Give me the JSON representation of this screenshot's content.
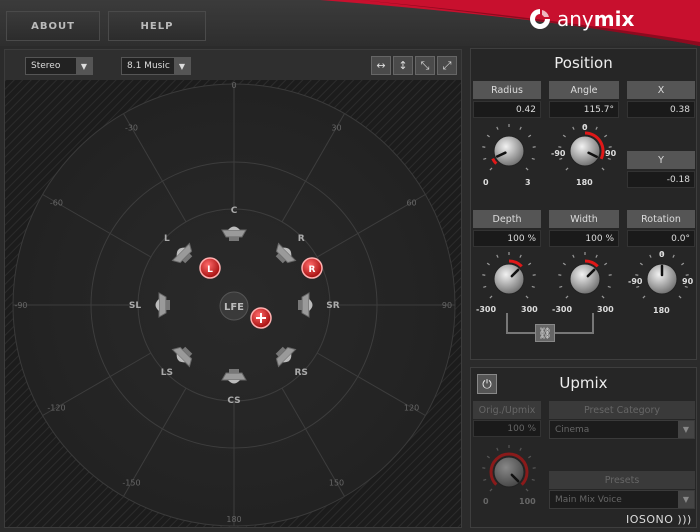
{
  "header": {
    "about_label": "ABOUT",
    "help_label": "HELP",
    "brand_prefix": "any",
    "brand_bold": "mix",
    "accent_color": "#c8102e"
  },
  "toolbar": {
    "input_format": "Stereo",
    "output_format": "8.1 Music",
    "zoom_icons": [
      "horizontal-arrows-icon",
      "vertical-arrows-icon",
      "diagonal-down-arrows-icon",
      "diagonal-up-arrows-icon"
    ]
  },
  "stage": {
    "angle_labels": [
      "0",
      "30",
      "60",
      "90",
      "120",
      "150",
      "180",
      "-150",
      "-120",
      "-90",
      "-60",
      "-30"
    ],
    "speakers": [
      "C",
      "L",
      "R",
      "SL",
      "SR",
      "LS",
      "RS",
      "CS"
    ],
    "lfe_label": "LFE",
    "source_left": "L",
    "source_right": "R"
  },
  "position": {
    "title": "Position",
    "radius_label": "Radius",
    "radius_value": "0.42",
    "radius_min": "0",
    "radius_max": "3",
    "angle_label": "Angle",
    "angle_value": "115.7°",
    "angle_top": "0",
    "angle_left": "-90",
    "angle_right": "90",
    "angle_bottom": "180",
    "x_label": "X",
    "x_value": "0.38",
    "y_label": "Y",
    "y_value": "-0.18",
    "depth_label": "Depth",
    "depth_value": "100 %",
    "depth_min": "-300",
    "depth_max": "300",
    "width_label": "Width",
    "width_value": "100 %",
    "width_min": "-300",
    "width_max": "300",
    "rotation_label": "Rotation",
    "rotation_value": "0.0°",
    "rotation_top": "0",
    "rotation_left": "-90",
    "rotation_right": "90",
    "rotation_bottom": "180"
  },
  "upmix": {
    "title": "Upmix",
    "orig_label": "Orig./Upmix",
    "orig_value": "100 %",
    "orig_min": "0",
    "orig_max": "100",
    "preset_category_label": "Preset Category",
    "preset_category_value": "Cinema",
    "presets_label": "Presets",
    "presets_value": "Main Mix Voice"
  },
  "footer": {
    "logo": "IOSONO )))"
  }
}
